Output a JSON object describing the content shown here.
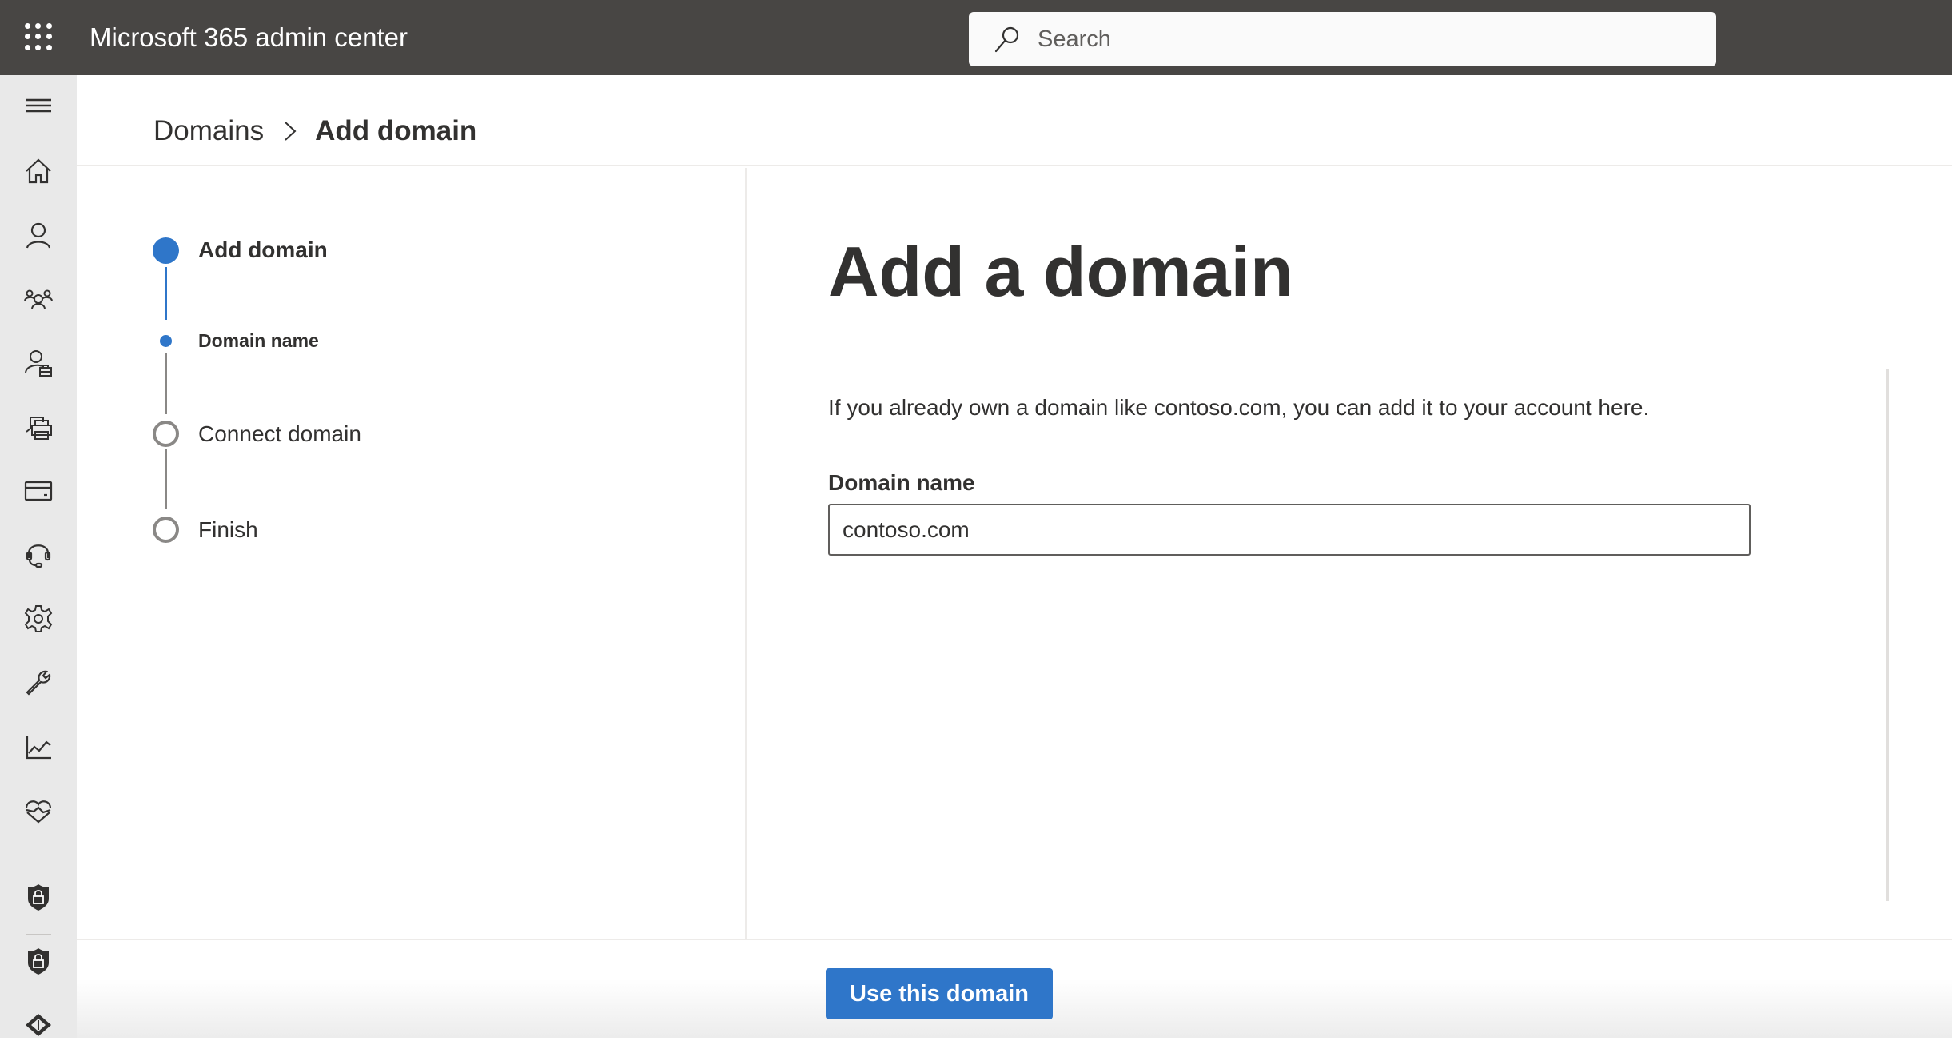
{
  "app": {
    "title": "Microsoft 365 admin center",
    "search_placeholder": "Search"
  },
  "colors": {
    "accent": "#2f76c9",
    "topbar": "#484644",
    "sidebar": "#e9e9e9",
    "inactive_step": "#8a8886"
  },
  "sidebar": {
    "items": [
      {
        "icon": "hamburger-menu-icon"
      },
      {
        "icon": "home-icon"
      },
      {
        "icon": "user-icon"
      },
      {
        "icon": "groups-icon"
      },
      {
        "icon": "roles-icon"
      },
      {
        "icon": "resources-icon"
      },
      {
        "icon": "billing-icon"
      },
      {
        "icon": "support-icon"
      },
      {
        "icon": "settings-icon"
      },
      {
        "icon": "setup-icon"
      },
      {
        "icon": "reports-icon"
      },
      {
        "icon": "health-icon"
      },
      {
        "icon": "security-icon"
      },
      {
        "icon": "compliance-icon"
      },
      {
        "icon": "admin-centers-icon"
      }
    ]
  },
  "breadcrumb": {
    "parent": "Domains",
    "current": "Add domain"
  },
  "stepper": {
    "steps": [
      {
        "label": "Add domain",
        "state": "active"
      },
      {
        "label": "Domain name",
        "state": "active-substep"
      },
      {
        "label": "Connect domain",
        "state": "pending"
      },
      {
        "label": "Finish",
        "state": "pending"
      }
    ]
  },
  "main": {
    "title": "Add a domain",
    "description": "If you already own a domain like contoso.com, you can add it to your account here.",
    "field_label": "Domain name",
    "field_value": "contoso.com"
  },
  "footer": {
    "primary_button": "Use this domain"
  }
}
